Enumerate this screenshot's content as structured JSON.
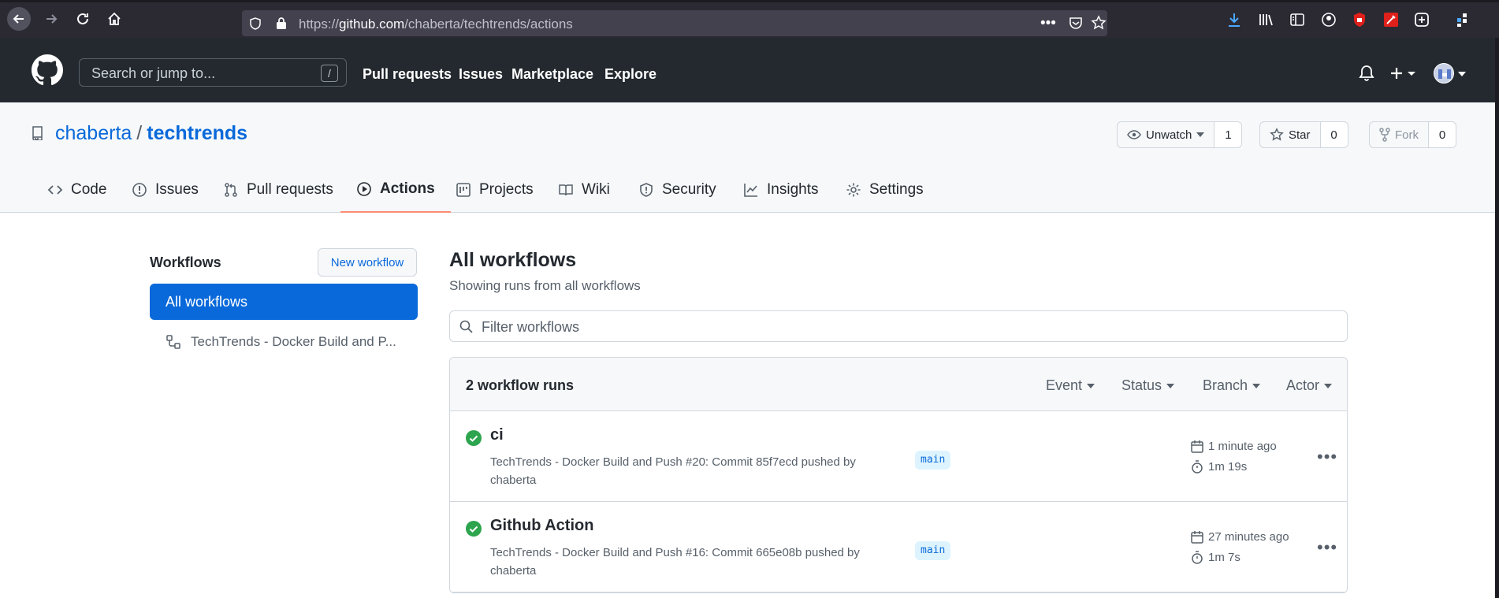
{
  "browser": {
    "url_prefix": "https://",
    "url_host": "github.com",
    "url_path": "/chaberta/techtrends/actions"
  },
  "header": {
    "search_placeholder": "Search or jump to...",
    "search_shortcut": "/",
    "nav": [
      "Pull requests",
      "Issues",
      "Marketplace",
      "Explore"
    ]
  },
  "repo": {
    "owner": "chaberta",
    "separator": "/",
    "name": "techtrends",
    "watch_label": "Unwatch",
    "watch_count": "1",
    "star_label": "Star",
    "star_count": "0",
    "fork_label": "Fork",
    "fork_count": "0",
    "tabs": [
      "Code",
      "Issues",
      "Pull requests",
      "Actions",
      "Projects",
      "Wiki",
      "Security",
      "Insights",
      "Settings"
    ],
    "active_tab": "Actions"
  },
  "sidebar": {
    "title": "Workflows",
    "new_workflow": "New workflow",
    "all_workflows": "All workflows",
    "items": [
      "TechTrends - Docker Build and P..."
    ]
  },
  "main": {
    "title": "All workflows",
    "subtitle": "Showing runs from all workflows",
    "filter_placeholder": "Filter workflows",
    "runs_count": "2 workflow runs",
    "filters": [
      "Event",
      "Status",
      "Branch",
      "Actor"
    ],
    "runs": [
      {
        "title": "ci",
        "workflow": "TechTrends - Docker Build and Push",
        "detail": "#20: Commit 85f7ecd pushed by",
        "author": "chaberta",
        "branch": "main",
        "time": "1 minute ago",
        "duration": "1m 19s"
      },
      {
        "title": "Github Action",
        "workflow": "TechTrends - Docker Build and Push",
        "detail": "#16: Commit 665e08b pushed by",
        "author": "chaberta",
        "branch": "main",
        "time": "27 minutes ago",
        "duration": "1m 7s"
      }
    ]
  },
  "colors": {
    "accent": "#0969da",
    "success": "#2da44e",
    "header_bg": "#24292f",
    "active_tab_underline": "#fd8c73"
  }
}
